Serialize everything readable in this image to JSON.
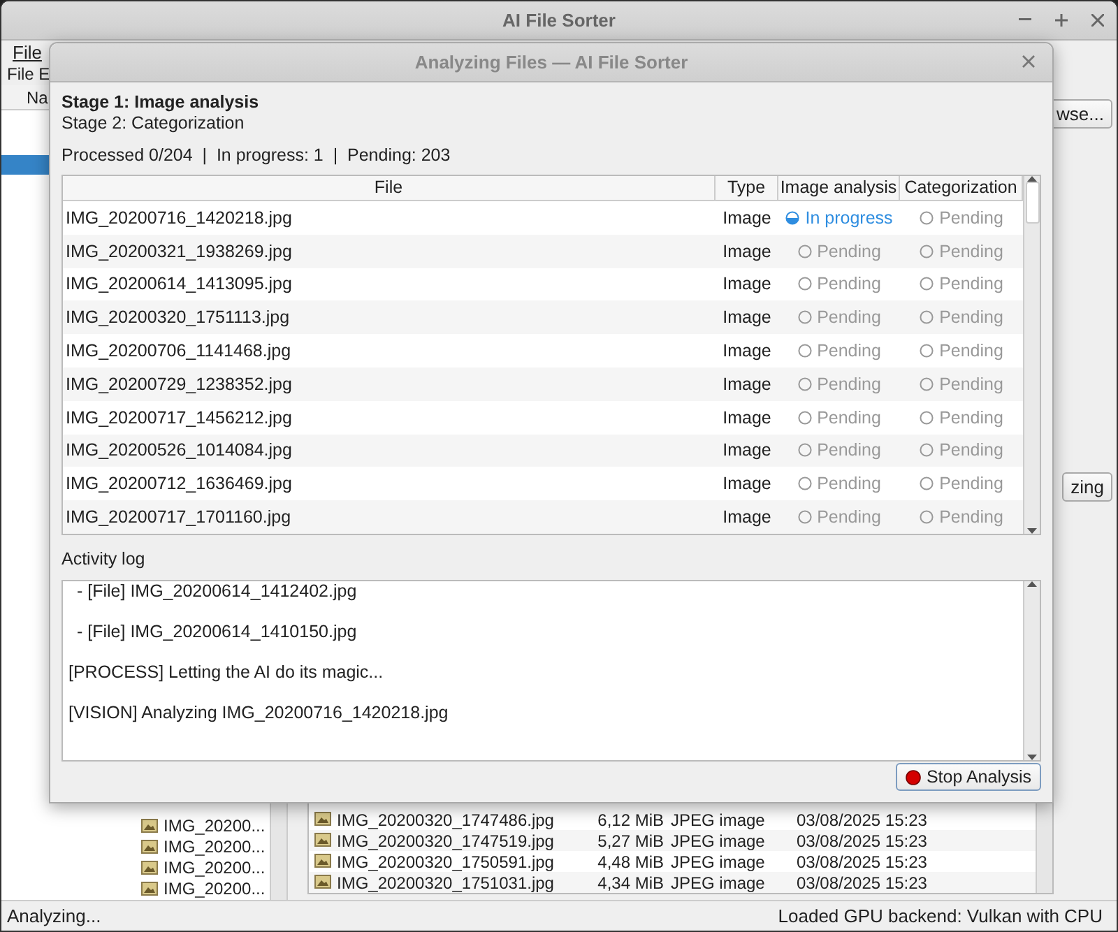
{
  "main_window": {
    "title": "AI File Sorter",
    "menu": [
      "File"
    ],
    "toolbar_label": "File E",
    "tree_header": "Na",
    "browse_button": "wse...",
    "analyze_button": "zing",
    "tree_items": [
      "IMG_20200...",
      "IMG_20200...",
      "IMG_20200...",
      "IMG_20200..."
    ],
    "files": [
      {
        "name": "IMG_20200320_1747486.jpg",
        "size": "6,12 MiB",
        "type": "JPEG image",
        "date": "03/08/2025 15:23"
      },
      {
        "name": "IMG_20200320_1747519.jpg",
        "size": "5,27 MiB",
        "type": "JPEG image",
        "date": "03/08/2025 15:23"
      },
      {
        "name": "IMG_20200320_1750591.jpg",
        "size": "4,48 MiB",
        "type": "JPEG image",
        "date": "03/08/2025 15:23"
      },
      {
        "name": "IMG_20200320_1751031.jpg",
        "size": "4,34 MiB",
        "type": "JPEG image",
        "date": "03/08/2025 15:23"
      }
    ],
    "status_left": "Analyzing...",
    "status_right": "Loaded GPU backend: Vulkan with CPU"
  },
  "dialog": {
    "title": "Analyzing Files — AI File Sorter",
    "stages": [
      {
        "label": "Stage 1: Image analysis",
        "active": true
      },
      {
        "label": "Stage 2: Categorization",
        "active": false
      }
    ],
    "summary": "Processed 0/204  |  In progress: 1  |  Pending: 203",
    "columns": [
      "File",
      "Type",
      "Image analysis",
      "Categorization"
    ],
    "rows": [
      {
        "file": "IMG_20200716_1420218.jpg",
        "type": "Image",
        "image_analysis": {
          "kind": "in_progress",
          "label": "In progress"
        },
        "categorization": {
          "kind": "pending",
          "label": "Pending"
        }
      },
      {
        "file": "IMG_20200321_1938269.jpg",
        "type": "Image",
        "image_analysis": {
          "kind": "pending",
          "label": "Pending"
        },
        "categorization": {
          "kind": "pending",
          "label": "Pending"
        }
      },
      {
        "file": "IMG_20200614_1413095.jpg",
        "type": "Image",
        "image_analysis": {
          "kind": "pending",
          "label": "Pending"
        },
        "categorization": {
          "kind": "pending",
          "label": "Pending"
        }
      },
      {
        "file": "IMG_20200320_1751113.jpg",
        "type": "Image",
        "image_analysis": {
          "kind": "pending",
          "label": "Pending"
        },
        "categorization": {
          "kind": "pending",
          "label": "Pending"
        }
      },
      {
        "file": "IMG_20200706_1141468.jpg",
        "type": "Image",
        "image_analysis": {
          "kind": "pending",
          "label": "Pending"
        },
        "categorization": {
          "kind": "pending",
          "label": "Pending"
        }
      },
      {
        "file": "IMG_20200729_1238352.jpg",
        "type": "Image",
        "image_analysis": {
          "kind": "pending",
          "label": "Pending"
        },
        "categorization": {
          "kind": "pending",
          "label": "Pending"
        }
      },
      {
        "file": "IMG_20200717_1456212.jpg",
        "type": "Image",
        "image_analysis": {
          "kind": "pending",
          "label": "Pending"
        },
        "categorization": {
          "kind": "pending",
          "label": "Pending"
        }
      },
      {
        "file": "IMG_20200526_1014084.jpg",
        "type": "Image",
        "image_analysis": {
          "kind": "pending",
          "label": "Pending"
        },
        "categorization": {
          "kind": "pending",
          "label": "Pending"
        }
      },
      {
        "file": "IMG_20200712_1636469.jpg",
        "type": "Image",
        "image_analysis": {
          "kind": "pending",
          "label": "Pending"
        },
        "categorization": {
          "kind": "pending",
          "label": "Pending"
        }
      },
      {
        "file": "IMG_20200717_1701160.jpg",
        "type": "Image",
        "image_analysis": {
          "kind": "pending",
          "label": "Pending"
        },
        "categorization": {
          "kind": "pending",
          "label": "Pending"
        }
      }
    ],
    "log_label": "Activity log",
    "log": [
      {
        "kind": "sub",
        "text": "- [File] IMG_20200614_1412402.jpg"
      },
      {
        "kind": "sub",
        "text": "- [File] IMG_20200614_1410150.jpg"
      },
      {
        "kind": "main",
        "text": "[PROCESS] Letting the AI do its magic..."
      },
      {
        "kind": "main",
        "text": "[VISION] Analyzing IMG_20200716_1420218.jpg"
      }
    ],
    "stop_button": "Stop Analysis"
  }
}
